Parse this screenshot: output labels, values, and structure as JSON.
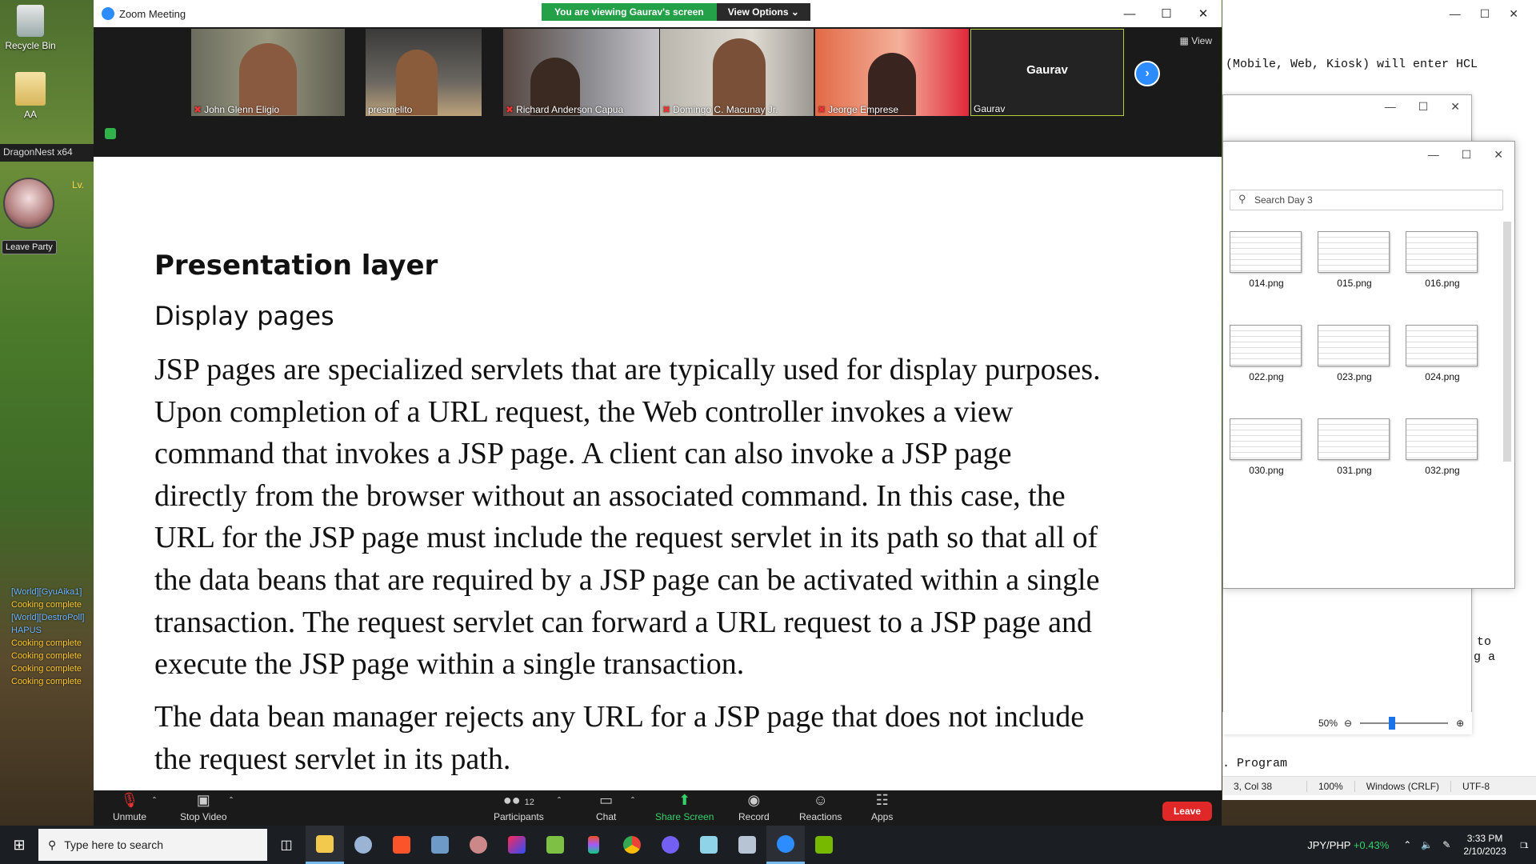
{
  "desktop": {
    "icons": [
      {
        "label": "Recycle Bin"
      },
      {
        "label": "AA"
      }
    ]
  },
  "game": {
    "title": "DragonNest x64",
    "level_prefix": "Lv.",
    "leave_party": "Leave Party",
    "chat": [
      {
        "text": "[World][GyuAika1]",
        "kind": "world"
      },
      {
        "text": "Cooking complete",
        "kind": "sys"
      },
      {
        "text": "[World][DestroPoll]",
        "kind": "world"
      },
      {
        "text": "HAPUS",
        "kind": "world"
      },
      {
        "text": "Cooking complete",
        "kind": "sys"
      },
      {
        "text": "Cooking complete",
        "kind": "sys"
      },
      {
        "text": "Cooking complete",
        "kind": "sys"
      },
      {
        "text": "Cooking complete",
        "kind": "sys"
      }
    ]
  },
  "notepad": {
    "line_top": "(Mobile, Web, Kiosk) will enter HCL",
    "line_to": "to",
    "line_ga": "g a",
    "line_program": ". Program",
    "status": {
      "position": "3, Col 38",
      "zoom": "100%",
      "eol": "Windows (CRLF)",
      "encoding": "UTF-8"
    }
  },
  "explorer": {
    "search_placeholder": "Search Day 3",
    "thumbnails": [
      "014.png",
      "015.png",
      "016.png",
      "022.png",
      "023.png",
      "024.png",
      "030.png",
      "031.png",
      "032.png"
    ],
    "zoom_level": "50%"
  },
  "zoom": {
    "window_title": "Zoom Meeting",
    "viewing_banner": "You are viewing Gaurav's screen",
    "view_options": "View Options",
    "view_label": "View",
    "participants": [
      {
        "name": "John Glenn Eligio",
        "muted": true
      },
      {
        "name": "presmelito",
        "muted": false
      },
      {
        "name": "Richard Anderson Capua",
        "muted": true
      },
      {
        "name": "Domingo C. Macunay Jr.",
        "muted": true
      },
      {
        "name": "Jeorge Emprese",
        "muted": true
      }
    ],
    "presenter": {
      "big_name": "Gaurav",
      "small_name": "Gaurav"
    },
    "slide": {
      "heading": "Presentation layer",
      "subheading": "Display pages",
      "paragraph1_lines": [
        "JSP pages are specialized servlets that are typically used for display purposes.",
        "Upon completion of a URL request, the Web controller invokes a view",
        "command that invokes a JSP page. A client can also invoke a JSP page",
        "directly from the browser without an associated command. In this case, the",
        "URL for the JSP page must include the request servlet in its path so that all of",
        "the data beans that are required by a JSP page can be activated within a single",
        "transaction. The request servlet can forward a URL request to a JSP page and",
        "execute the JSP page within a single transaction."
      ],
      "paragraph2_lines": [
        "The data bean manager rejects any URL for a JSP page that does not include",
        "the request servlet in its path."
      ]
    },
    "toolbar": {
      "unmute": "Unmute",
      "stop_video": "Stop Video",
      "participants": "Participants",
      "participant_count": "12",
      "chat": "Chat",
      "share_screen": "Share Screen",
      "record": "Record",
      "reactions": "Reactions",
      "apps": "Apps",
      "leave": "Leave"
    }
  },
  "taskbar": {
    "search_placeholder": "Type here to search",
    "currency_pair": "JPY/PHP",
    "currency_change": "+0.43%",
    "time": "3:33 PM",
    "date": "2/10/2023",
    "notification_count": "1"
  }
}
